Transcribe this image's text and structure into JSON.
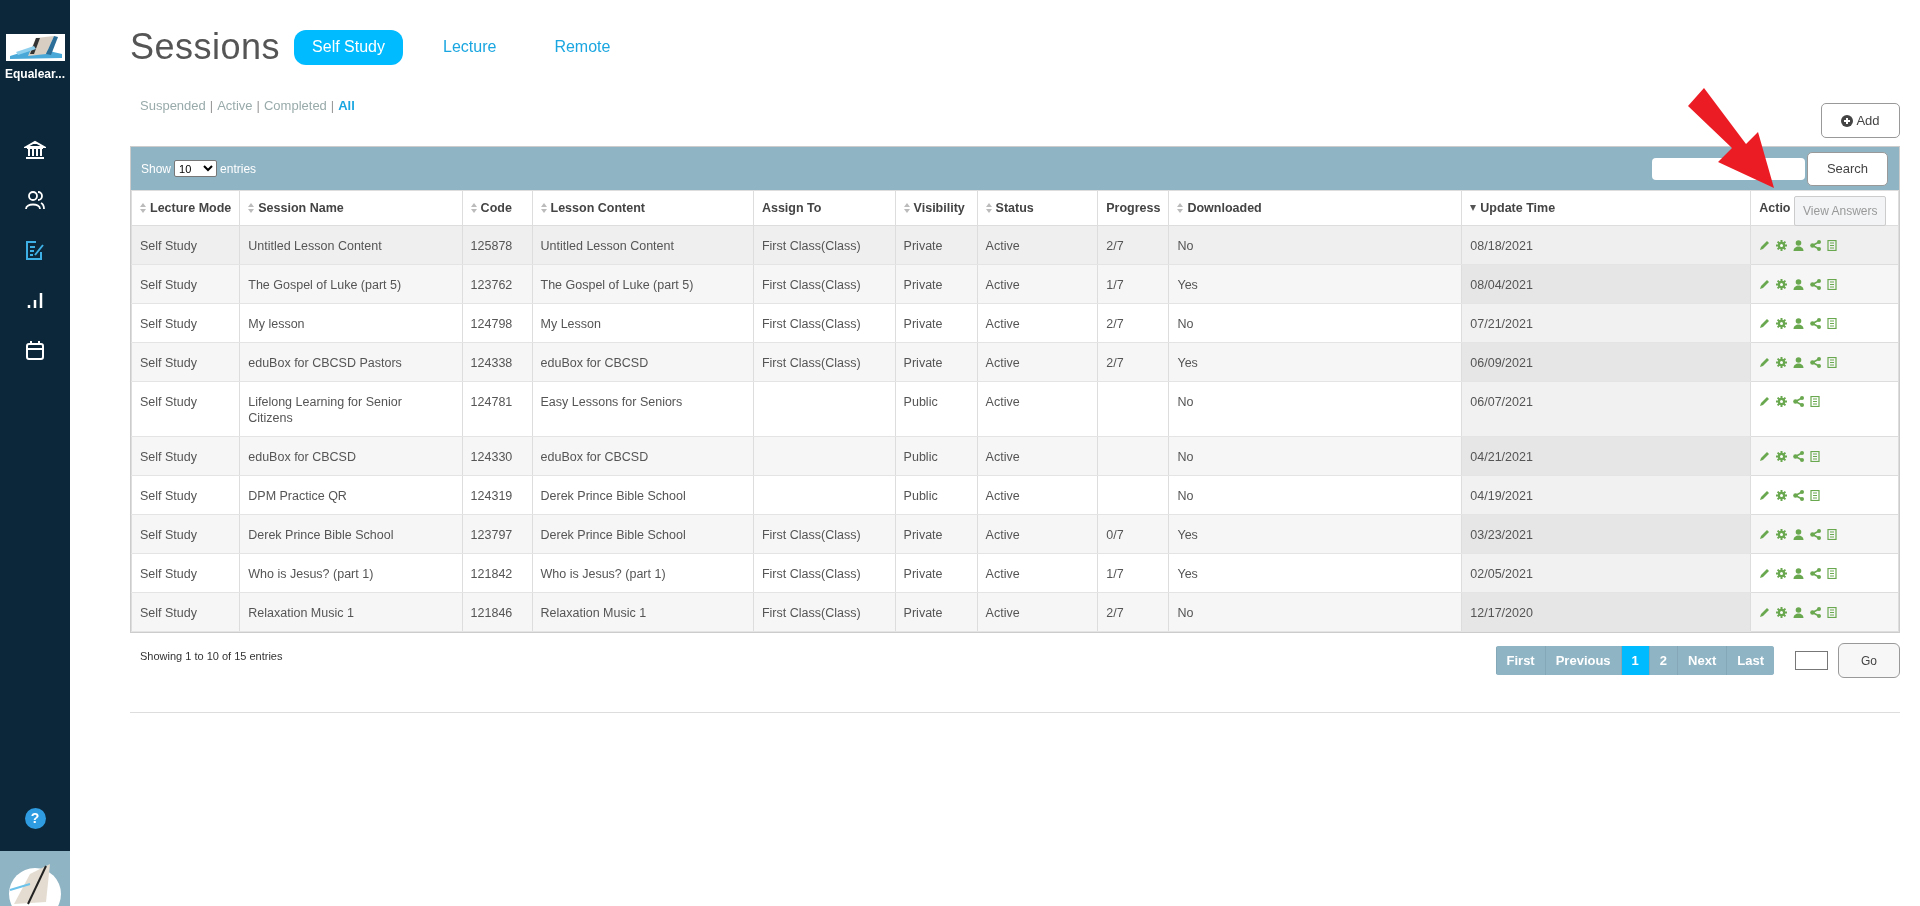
{
  "sidebar": {
    "org_name": "Equalear...",
    "nav": [
      {
        "selected": false
      },
      {
        "selected": false
      },
      {
        "selected": true
      },
      {
        "selected": false
      },
      {
        "selected": false
      }
    ],
    "help": "?"
  },
  "title": "Sessions",
  "tabs": [
    {
      "label": "Self Study",
      "selected": true
    },
    {
      "label": "Lecture",
      "selected": false
    },
    {
      "label": "Remote",
      "selected": false
    }
  ],
  "filters": {
    "separator": "|",
    "items": [
      {
        "label": "Suspended",
        "selected": false
      },
      {
        "label": "Active",
        "selected": false
      },
      {
        "label": "Completed",
        "selected": false
      },
      {
        "label": "All",
        "selected": true
      }
    ]
  },
  "add_button": "Add",
  "toolbar": {
    "show_label": "Show",
    "page_size": "10",
    "entries_label": "entries",
    "search_button": "Search"
  },
  "table": {
    "columns": [
      {
        "label": "Lecture Mode",
        "kind": "sortable"
      },
      {
        "label": "Session Name",
        "kind": "sortable"
      },
      {
        "label": "Code",
        "kind": "sortable"
      },
      {
        "label": "Lesson Content",
        "kind": "sortable"
      },
      {
        "label": "Assign To",
        "kind": "plain"
      },
      {
        "label": "Visibility",
        "kind": "sortable"
      },
      {
        "label": "Status",
        "kind": "sortable"
      },
      {
        "label": "Progress",
        "kind": "plain"
      },
      {
        "label": "Downloaded",
        "kind": "sortable"
      },
      {
        "label": "Update Time",
        "kind": "sorted"
      },
      {
        "label": "Actio",
        "kind": "plain"
      }
    ],
    "rows": [
      {
        "cells": [
          "Self Study",
          "Untitled Lesson Content",
          "125878",
          "Untitled Lesson Content",
          "First Class(Class)",
          "Private",
          "Active",
          "2/7",
          "No",
          "08/18/2021"
        ],
        "kind": "assigned"
      },
      {
        "cells": [
          "Self Study",
          "The Gospel of Luke (part 5)",
          "123762",
          "The Gospel of Luke (part 5)",
          "First Class(Class)",
          "Private",
          "Active",
          "1/7",
          "Yes",
          "08/04/2021"
        ],
        "kind": "assigned"
      },
      {
        "cells": [
          "Self Study",
          "My lesson",
          "124798",
          "My Lesson",
          "First Class(Class)",
          "Private",
          "Active",
          "2/7",
          "No",
          "07/21/2021"
        ],
        "kind": "assigned"
      },
      {
        "cells": [
          "Self Study",
          "eduBox for CBCSD Pastors",
          "124338",
          "eduBox for CBCSD",
          "First Class(Class)",
          "Private",
          "Active",
          "2/7",
          "Yes",
          "06/09/2021"
        ],
        "kind": "assigned"
      },
      {
        "cells": [
          "Self Study",
          "Lifelong Learning for Senior Citizens",
          "124781",
          "Easy Lessons for Seniors",
          "",
          "Public",
          "Active",
          "",
          "No",
          "06/07/2021"
        ],
        "kind": "public"
      },
      {
        "cells": [
          "Self Study",
          "eduBox for CBCSD",
          "124330",
          "eduBox for CBCSD",
          "",
          "Public",
          "Active",
          "",
          "No",
          "04/21/2021"
        ],
        "kind": "public"
      },
      {
        "cells": [
          "Self Study",
          "DPM Practice QR",
          "124319",
          "Derek Prince Bible School",
          "",
          "Public",
          "Active",
          "",
          "No",
          "04/19/2021"
        ],
        "kind": "public"
      },
      {
        "cells": [
          "Self Study",
          "Derek Prince Bible School",
          "123797",
          "Derek Prince Bible School",
          "First Class(Class)",
          "Private",
          "Active",
          "0/7",
          "Yes",
          "03/23/2021"
        ],
        "kind": "assigned"
      },
      {
        "cells": [
          "Self Study",
          "Who is Jesus? (part 1)",
          "121842",
          "Who is Jesus? (part 1)",
          "First Class(Class)",
          "Private",
          "Active",
          "1/7",
          "Yes",
          "02/05/2021"
        ],
        "kind": "assigned"
      },
      {
        "cells": [
          "Self Study",
          "Relaxation Music 1",
          "121846",
          "Relaxation Music 1",
          "First Class(Class)",
          "Private",
          "Active",
          "2/7",
          "No",
          "12/17/2020"
        ],
        "kind": "assigned"
      }
    ]
  },
  "tooltip": "View Answers",
  "summary": "Showing 1 to 10 of 15 entries",
  "pagination": [
    {
      "label": "First",
      "selected": false
    },
    {
      "label": "Previous",
      "selected": false
    },
    {
      "label": "1",
      "selected": true
    },
    {
      "label": "2",
      "selected": false
    },
    {
      "label": "Next",
      "selected": false
    },
    {
      "label": "Last",
      "selected": false
    }
  ],
  "go_button": "Go"
}
